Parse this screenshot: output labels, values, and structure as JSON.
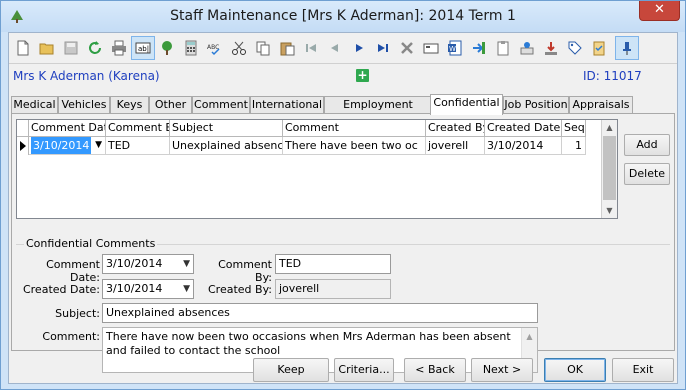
{
  "window": {
    "title": "Staff Maintenance  [Mrs K Aderman]:  2014 Term 1",
    "close_glyph": "✕"
  },
  "toolbar": {
    "icons": [
      "new-document-icon",
      "open-folder-icon",
      "save-icon",
      "refresh-icon",
      "print-icon",
      "text-field-icon",
      "tree-icon",
      "calculator-icon",
      "spellcheck-icon",
      "cut-icon",
      "copy-icon",
      "paste-icon",
      "first-record-icon",
      "previous-record-icon",
      "next-record-icon",
      "last-record-icon",
      "delete-icon",
      "card-icon",
      "word-document-icon",
      "export-icon",
      "clipboard-icon",
      "approve-icon",
      "download-icon",
      "tag-icon",
      "checklist-icon",
      "pin-icon"
    ]
  },
  "header": {
    "staff_name": "Mrs K Aderman (Karena)",
    "id_label": "ID: 11017"
  },
  "tabs": [
    "Medical",
    "Vehicles",
    "Keys",
    "Other",
    "Comment",
    "International",
    "Employment History",
    "Confidential",
    "Job Position",
    "Appraisals"
  ],
  "selected_tab": "Confidential",
  "grid": {
    "columns": [
      "Comment Date",
      "Comment By",
      "Subject",
      "Comment",
      "Created By",
      "Created Date",
      "Seq"
    ],
    "rows": [
      {
        "comment_date": "3/10/2014",
        "comment_by": "TED",
        "subject": "Unexplained absences",
        "comment": "There have been two oc",
        "created_by": "joverell",
        "created_date": "3/10/2014",
        "seq": "1"
      }
    ]
  },
  "side_buttons": {
    "add": "Add",
    "delete": "Delete"
  },
  "form": {
    "group_title": "Confidential Comments",
    "comment_date_label": "Comment Date:",
    "comment_date_value": "3/10/2014",
    "comment_by_label": "Comment By:",
    "comment_by_value": "TED",
    "created_date_label": "Created Date:",
    "created_date_value": "3/10/2014",
    "created_by_label": "Created By:",
    "created_by_value": "joverell",
    "subject_label": "Subject:",
    "subject_value": "Unexplained absences",
    "comment_label": "Comment:",
    "comment_value": "There have now been two occasions when Mrs Aderman has been absent and failed to contact the school"
  },
  "bottom_buttons": {
    "keep": "Keep",
    "criteria": "Criteria...",
    "back": "< Back",
    "next": "Next >",
    "ok": "OK",
    "exit": "Exit"
  },
  "colors": {
    "accent": "#1f3fbf",
    "selection": "#3399ff",
    "plus_green": "#2fa84f",
    "close_red": "#c7473b"
  }
}
